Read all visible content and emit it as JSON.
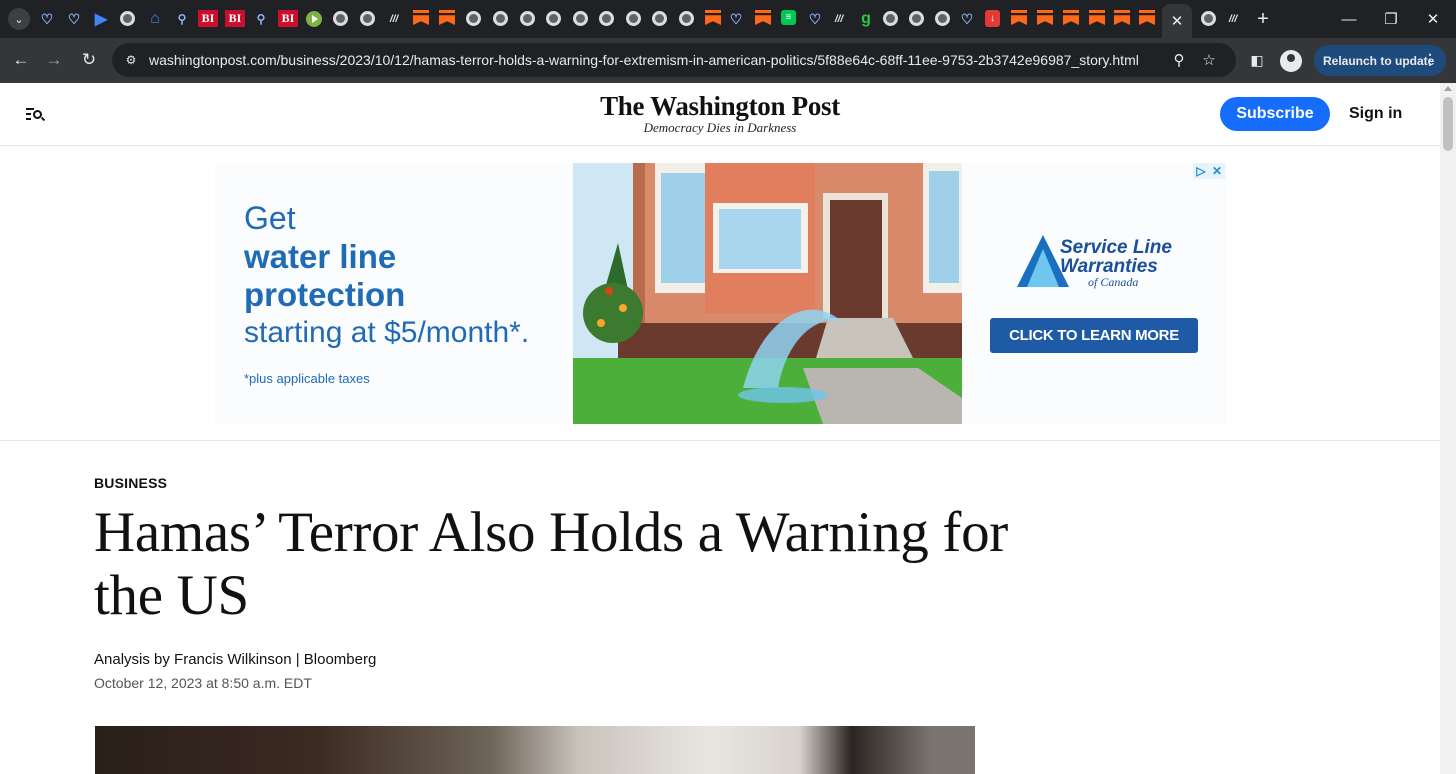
{
  "browser": {
    "url": "washingtonpost.com/business/2023/10/12/hamas-terror-holds-a-warning-for-extremism-in-american-politics/5f88e64c-68ff-11ee-9753-2b3742e96987_story.html",
    "relaunch_label": "Relaunch to update",
    "tab_bi_label": "BI",
    "tab_g_label": "g"
  },
  "masthead": {
    "logo": "The Washington Post",
    "tagline": "Democracy Dies in Darkness",
    "subscribe": "Subscribe",
    "sign_in": "Sign in"
  },
  "ad": {
    "line1": "Get",
    "line2": "water line protection",
    "line3": "starting at $5/month*.",
    "fine_print": "*plus applicable taxes",
    "brand": "Service Line Warranties",
    "brand_sub": "of Canada",
    "cta": "CLICK TO LEARN MORE"
  },
  "article": {
    "section": "BUSINESS",
    "headline": "Hamas’ Terror Also Holds a Warning for the US",
    "byline": "Analysis by Francis Wilkinson | Bloomberg",
    "date": "October 12, 2023 at 8:50 a.m. EDT"
  }
}
